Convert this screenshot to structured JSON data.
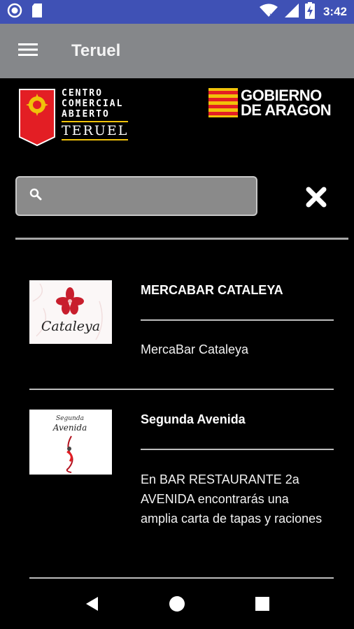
{
  "status_bar": {
    "time": "3:42",
    "icons": [
      "circle-notification-icon",
      "sd-card-icon",
      "wifi-icon",
      "signal-icon",
      "battery-charging-icon"
    ]
  },
  "app_bar": {
    "title": "Teruel",
    "menu_icon": "hamburger-menu-icon"
  },
  "logos": {
    "cca": {
      "line1": "CENTRO",
      "line2": "COMERCIAL",
      "line3": "ABIERTO",
      "line4": "TERUEL"
    },
    "gobierno": {
      "line1": "GOBIERNO",
      "line2": "DE ARAGON"
    }
  },
  "search": {
    "value": "",
    "placeholder": "",
    "search_icon": "search-icon",
    "clear_icon": "close-icon"
  },
  "items": [
    {
      "title": "MERCABAR CATALEYA",
      "description": "MercaBar Cataleya",
      "thumb_text": "Cataleya"
    },
    {
      "title": "Segunda Avenida",
      "description": "En BAR RESTAURANTE 2a AVENIDA encontrarás una amplia carta de tapas y raciones",
      "thumb_text_1": "Segunda",
      "thumb_text_2": "Avenida"
    }
  ],
  "colors": {
    "status_bar": "#3f51b5",
    "app_bar": "#85878a",
    "background": "#000000",
    "accent_red": "#e31e24",
    "accent_yellow": "#f0c20a"
  }
}
